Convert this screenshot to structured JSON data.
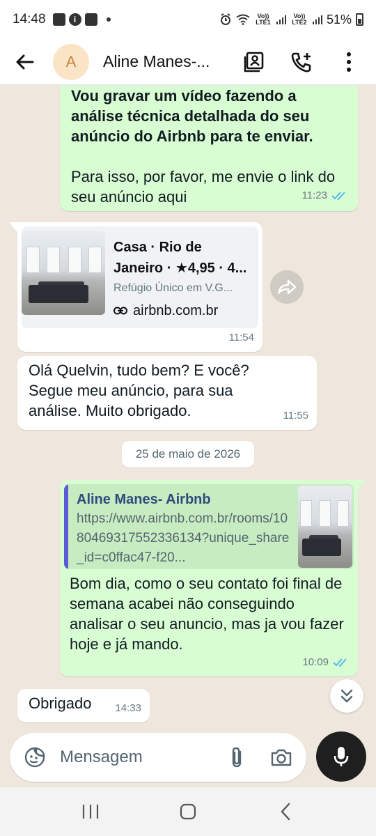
{
  "status_bar": {
    "time": "14:48",
    "volte1": "Vo)) LTE1",
    "volte2": "Vo)) LTE2",
    "battery": "51%"
  },
  "header": {
    "avatar_letter": "A",
    "contact_name": "Aline Manes-..."
  },
  "messages": [
    {
      "direction": "out",
      "bold_text": "Vou gravar um vídeo fazendo a análise técnica detalhada do seu anúncio do Airbnb para te enviar.",
      "text": "Para isso, por favor, me envie o link do seu anúncio aqui",
      "time": "11:23",
      "status": "read"
    },
    {
      "direction": "in",
      "link_preview": {
        "title_line1": "Casa · Rio de",
        "title_line2": "Janeiro · ★4,95 · 4...",
        "subtitle": "Refúgio Único em V.G...",
        "domain": "airbnb.com.br"
      },
      "time": "11:54"
    },
    {
      "direction": "in",
      "text": "Olá Quelvin, tudo bem? E você? Segue meu anúncio, para sua análise. Muito obrigado.",
      "time": "11:55"
    },
    {
      "direction": "out",
      "quote": {
        "author": "Aline Manes- Airbnb",
        "text": "https://www.airbnb.com.br/rooms/1080469317552336134?unique_share_id=c0ffac47-f20..."
      },
      "text": "Bom dia, como o seu contato foi final de semana acabei não conseguindo analisar o seu anuncio, mas ja vou fazer hoje e já mando.",
      "time": "10:09",
      "status": "read"
    },
    {
      "direction": "in",
      "text": "Obrigado",
      "time": "14:33"
    }
  ],
  "date_chip": "25 de maio de 2026",
  "composer": {
    "placeholder": "Mensagem"
  },
  "colors": {
    "outgoing_bubble": "#d9fdd3",
    "incoming_bubble": "#ffffff",
    "read_ticks": "#53bdeb",
    "chat_background": "#efe7dd"
  },
  "icons": {
    "back": "arrow-left-icon",
    "contact_card": "contact-card-icon",
    "add_call": "phone-plus-icon",
    "menu": "more-vertical-icon",
    "link": "link-icon",
    "forward": "forward-icon",
    "scroll_down": "double-chevron-down-icon",
    "emoji": "sticker-icon",
    "attach": "paperclip-icon",
    "camera": "camera-icon",
    "mic": "mic-icon"
  }
}
